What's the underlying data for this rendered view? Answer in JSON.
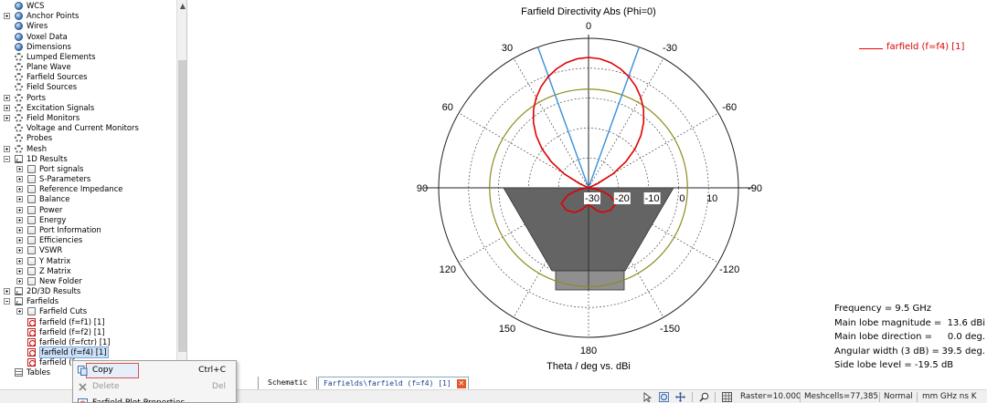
{
  "tree": {
    "items": [
      {
        "label": "WCS",
        "icon": "sphere",
        "depth": 0,
        "expander": "none"
      },
      {
        "label": "Anchor Points",
        "icon": "sphere",
        "depth": 0,
        "expander": "plus"
      },
      {
        "label": "Wires",
        "icon": "sphere",
        "depth": 0,
        "expander": "none"
      },
      {
        "label": "Voxel Data",
        "icon": "sphere",
        "depth": 0,
        "expander": "none"
      },
      {
        "label": "Dimensions",
        "icon": "sphere",
        "depth": 0,
        "expander": "none"
      },
      {
        "label": "Lumped Elements",
        "icon": "gear",
        "depth": 0,
        "expander": "none"
      },
      {
        "label": "Plane Wave",
        "icon": "gear",
        "depth": 0,
        "expander": "none"
      },
      {
        "label": "Farfield Sources",
        "icon": "gear",
        "depth": 0,
        "expander": "none"
      },
      {
        "label": "Field Sources",
        "icon": "gear",
        "depth": 0,
        "expander": "none"
      },
      {
        "label": "Ports",
        "icon": "gear",
        "depth": 0,
        "expander": "plus"
      },
      {
        "label": "Excitation Signals",
        "icon": "gear",
        "depth": 0,
        "expander": "plus"
      },
      {
        "label": "Field Monitors",
        "icon": "gear",
        "depth": 0,
        "expander": "plus"
      },
      {
        "label": "Voltage and Current Monitors",
        "icon": "gear",
        "depth": 0,
        "expander": "none"
      },
      {
        "label": "Probes",
        "icon": "gear",
        "depth": 0,
        "expander": "none"
      },
      {
        "label": "Mesh",
        "icon": "gear",
        "depth": 0,
        "expander": "plus"
      },
      {
        "label": "1D Results",
        "icon": "chart",
        "depth": 0,
        "expander": "minus"
      },
      {
        "label": "Port signals",
        "icon": "folder",
        "depth": 1,
        "expander": "plus"
      },
      {
        "label": "S-Parameters",
        "icon": "folder",
        "depth": 1,
        "expander": "plus"
      },
      {
        "label": "Reference Impedance",
        "icon": "folder",
        "depth": 1,
        "expander": "plus"
      },
      {
        "label": "Balance",
        "icon": "folder",
        "depth": 1,
        "expander": "plus"
      },
      {
        "label": "Power",
        "icon": "folder",
        "depth": 1,
        "expander": "plus"
      },
      {
        "label": "Energy",
        "icon": "folder",
        "depth": 1,
        "expander": "plus"
      },
      {
        "label": "Port Information",
        "icon": "folder",
        "depth": 1,
        "expander": "plus"
      },
      {
        "label": "Efficiencies",
        "icon": "folder",
        "depth": 1,
        "expander": "plus"
      },
      {
        "label": "VSWR",
        "icon": "folder",
        "depth": 1,
        "expander": "plus"
      },
      {
        "label": "Y Matrix",
        "icon": "folder",
        "depth": 1,
        "expander": "plus"
      },
      {
        "label": "Z Matrix",
        "icon": "folder",
        "depth": 1,
        "expander": "plus"
      },
      {
        "label": "New Folder",
        "icon": "folder",
        "depth": 1,
        "expander": "plus"
      },
      {
        "label": "2D/3D Results",
        "icon": "chart",
        "depth": 0,
        "expander": "plus"
      },
      {
        "label": "Farfields",
        "icon": "chart",
        "depth": 0,
        "expander": "minus"
      },
      {
        "label": "Farfield Cuts",
        "icon": "folder",
        "depth": 1,
        "expander": "plus"
      },
      {
        "label": "farfield (f=f1) [1]",
        "icon": "ff",
        "depth": 1,
        "expander": "none"
      },
      {
        "label": "farfield (f=f2) [1]",
        "icon": "ff",
        "depth": 1,
        "expander": "none"
      },
      {
        "label": "farfield (f=fctr) [1]",
        "icon": "ff",
        "depth": 1,
        "expander": "none"
      },
      {
        "label": "farfield (f=f4) [1]",
        "icon": "ff",
        "depth": 1,
        "expander": "none",
        "selected": true
      },
      {
        "label": "farfield (f",
        "icon": "ff",
        "depth": 1,
        "expander": "none"
      },
      {
        "label": "Tables",
        "icon": "table",
        "depth": 0,
        "expander": "none"
      }
    ]
  },
  "context_menu": {
    "copy": {
      "label": "Copy",
      "shortcut": "Ctrl+C"
    },
    "delete": {
      "label": "Delete",
      "shortcut": "Del"
    },
    "properties": {
      "label": "Farfield Plot Properties"
    }
  },
  "tabs": {
    "schematic": "Schematic",
    "farfield": "Farfields\\farfield (f=f4) [1]",
    "close_glyph": "✕"
  },
  "status_bar": {
    "raster": "Raster=10.000",
    "meshcells": "Meshcells=77,385",
    "mode": "Normal",
    "units": "mm  GHz  ns  K"
  },
  "plot": {
    "legend": "farfield (f=f4) [1]",
    "stats": [
      {
        "label": "Frequency = 9.5 GHz",
        "value": ""
      },
      {
        "label": "Main lobe magnitude =",
        "value": "13.6 dBi"
      },
      {
        "label": "Main lobe direction =",
        "value": "0.0 deg."
      },
      {
        "label": "Angular width (3 dB) =",
        "value": "39.5 deg."
      },
      {
        "label": "Side lobe level =  -19.5 dB",
        "value": ""
      }
    ],
    "colors": {
      "trace": "#e00000",
      "beam_lines": "#3a8fd8",
      "ref_circle": "#8c8c20",
      "fill": "#646464"
    }
  },
  "chart_data": {
    "type": "polar",
    "title": "Farfield Directivity Abs (Phi=0)",
    "xlabel": "Theta / deg vs. dBi",
    "angle_ticks": [
      {
        "label": "0",
        "deg": 0
      },
      {
        "label": "30",
        "deg": 30
      },
      {
        "label": "60",
        "deg": 60
      },
      {
        "label": "90",
        "deg": 90
      },
      {
        "label": "120",
        "deg": 120
      },
      {
        "label": "150",
        "deg": 150
      },
      {
        "label": "180",
        "deg": 180
      },
      {
        "label": "-150",
        "deg": -150
      },
      {
        "label": "-120",
        "deg": -120
      },
      {
        "label": "-90",
        "deg": -90
      },
      {
        "label": "-60",
        "deg": -60
      },
      {
        "label": "-30",
        "deg": -30
      }
    ],
    "radial_ticks": [
      {
        "label": "-30",
        "value": -30,
        "boxed": true
      },
      {
        "label": "-20",
        "value": -20,
        "boxed": true
      },
      {
        "label": "-10",
        "value": -10,
        "boxed": true
      },
      {
        "label": "0",
        "value": 0,
        "boxed": false
      },
      {
        "label": "10",
        "value": 10,
        "boxed": false
      }
    ],
    "radial_range": [
      -30,
      20
    ],
    "grid": true,
    "reference_level_dbi": 3,
    "beam_edges_deg": [
      -19.75,
      19.75
    ],
    "series": [
      {
        "name": "farfield (f=f4) [1]",
        "theta": [
          0,
          5,
          10,
          15,
          20,
          25,
          30,
          35,
          40,
          45,
          50,
          55,
          60,
          65,
          70,
          75,
          80,
          85,
          90,
          95,
          100,
          105,
          110,
          120,
          135,
          150,
          160,
          170,
          180,
          -170,
          -160,
          -150,
          -135,
          -120,
          -110,
          -105,
          -100,
          -95,
          -90,
          -85,
          -80,
          -75,
          -70,
          -65,
          -60,
          -55,
          -50,
          -45,
          -40,
          -35,
          -30,
          -25,
          -20,
          -15,
          -10,
          -5
        ],
        "r_dbi": [
          13.6,
          13.3,
          12.5,
          11.2,
          9.5,
          7.4,
          4.9,
          2,
          -1.4,
          -5.3,
          -9.8,
          -14.9,
          -20.5,
          -26.5,
          -30,
          -30,
          -30,
          -30,
          -30,
          -29.5,
          -27.5,
          -25,
          -22.5,
          -19.5,
          -19.5,
          -20.5,
          -22,
          -23.5,
          -24.5,
          -23.5,
          -22,
          -20.5,
          -19.5,
          -19.5,
          -22.5,
          -25,
          -27.5,
          -29.5,
          -30,
          -30,
          -30,
          -30,
          -30,
          -26.5,
          -20.5,
          -14.9,
          -9.8,
          -5.3,
          -1.4,
          2,
          4.9,
          7.4,
          9.5,
          11.2,
          12.5,
          13.3
        ]
      }
    ]
  }
}
